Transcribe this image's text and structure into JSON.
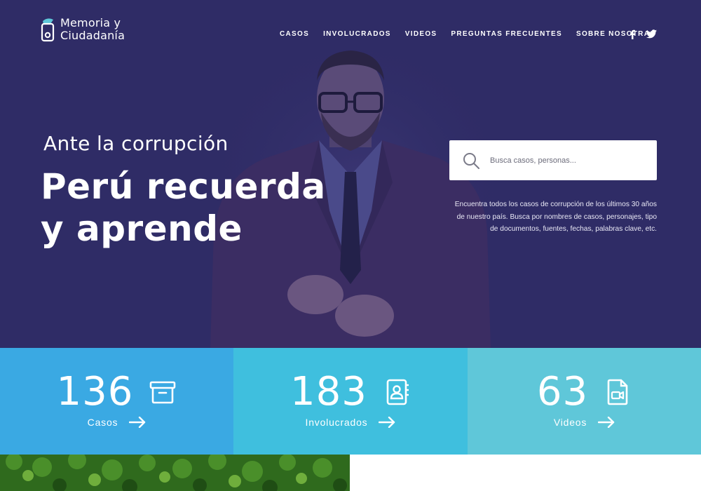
{
  "brand": {
    "line1": "Memoria y",
    "line2": "Ciudadanía"
  },
  "nav": {
    "items": [
      "CASOS",
      "INVOLUCRADOS",
      "VIDEOS",
      "PREGUNTAS FRECUENTES",
      "SOBRE NOSOTRAS"
    ],
    "social": [
      "facebook-icon",
      "twitter-icon"
    ]
  },
  "hero": {
    "kicker": "Ante la corrupción",
    "headline_line1": "Perú recuerda",
    "headline_line2": "y aprende"
  },
  "search": {
    "placeholder": "Busca casos, personas...",
    "description": "Encuentra todos los casos de corrupción de los últimos 30 años de nuestro país.  Busca por nombres de casos, personajes, tipo de documentos, fuentes, fechas, palabras clave, etc."
  },
  "stats": [
    {
      "value": "136",
      "label": "Casos",
      "icon": "archive-box-icon"
    },
    {
      "value": "183",
      "label": "Involucrados",
      "icon": "contacts-book-icon"
    },
    {
      "value": "63",
      "label": "Videos",
      "icon": "video-file-icon"
    }
  ],
  "colors": {
    "hero_bg": "#2f2c66",
    "stat_casos": "#3aa9e3",
    "stat_involucrados": "#3fbfde",
    "stat_videos": "#5fc7d9"
  }
}
